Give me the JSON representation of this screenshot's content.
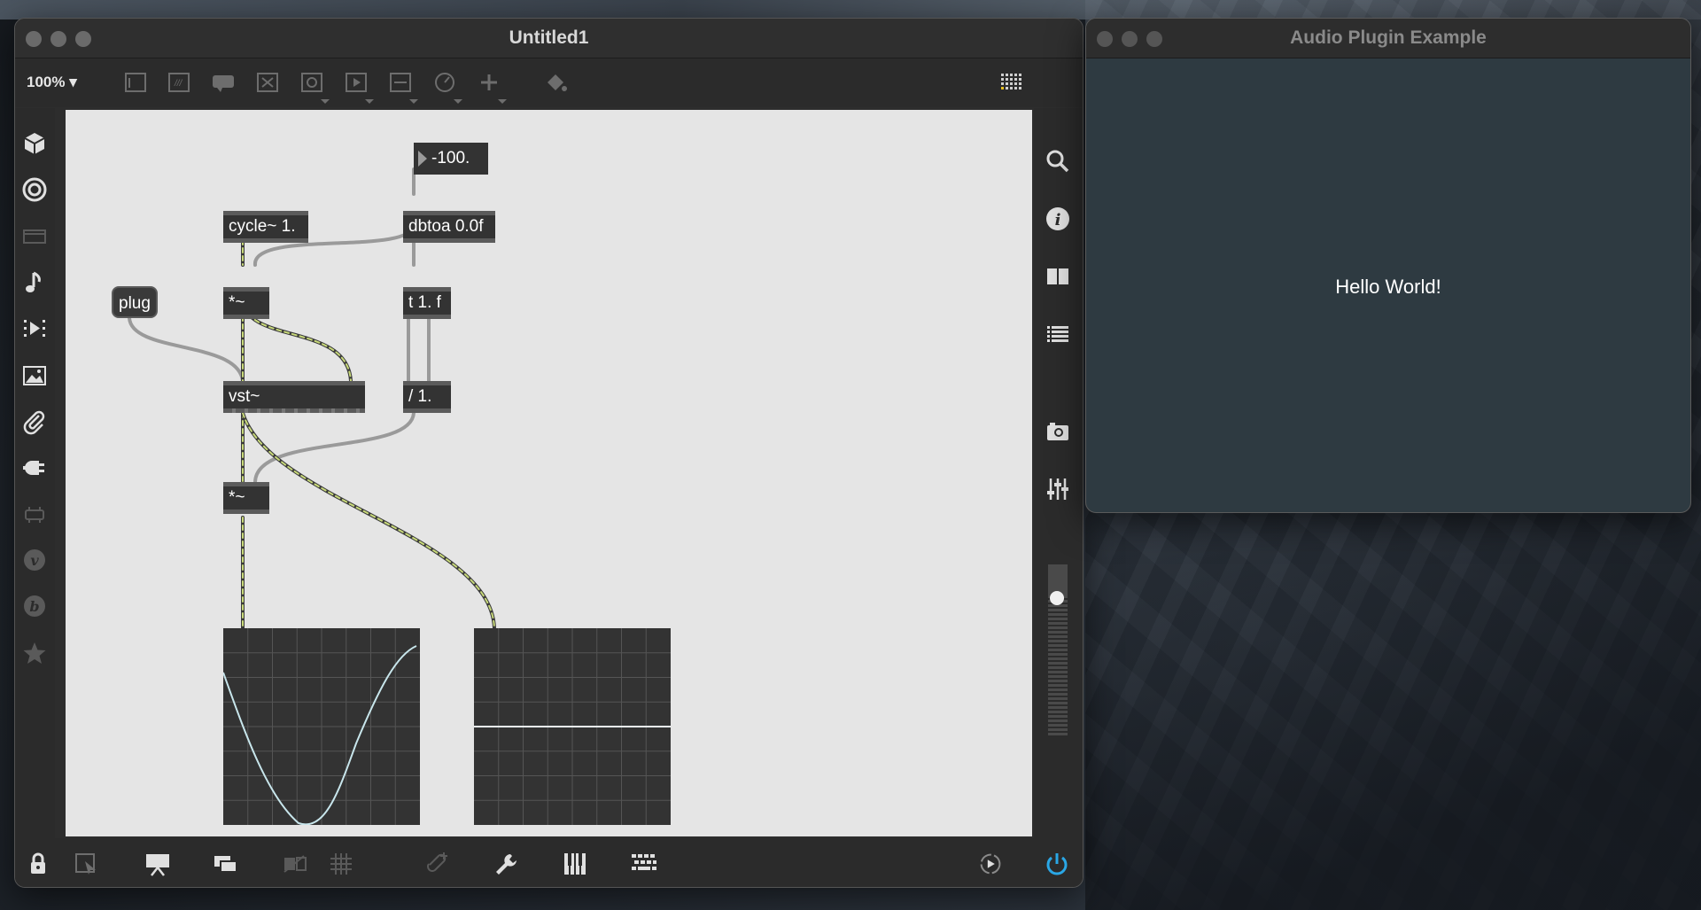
{
  "max_window": {
    "title": "Untitled1",
    "zoom": "100%",
    "toolbar_icons": [
      "presentation-icon",
      "comment-icon",
      "message-icon",
      "toggle-icon",
      "button-icon",
      "play-icon",
      "slider-icon",
      "dial-icon",
      "add-icon",
      "paint-bucket-icon",
      "grid-icon"
    ],
    "left_sidebar_icons": [
      "package-icon",
      "target-icon",
      "film-icon",
      "music-note-icon",
      "media-icon",
      "image-icon",
      "paperclip-icon",
      "plug-icon",
      "connector-icon",
      "v-icon",
      "b-icon",
      "star-icon"
    ],
    "right_sidebar_icons": [
      "search-icon",
      "info-icon",
      "split-view-icon",
      "list-icon",
      "camera-icon",
      "mixer-icon",
      "volume-slider"
    ],
    "bottom_icons": [
      "lock-icon",
      "selection-icon",
      "presentation-icon",
      "windows-icon",
      "hide-icon",
      "grid-icon",
      "add-object-icon",
      "wrench-icon",
      "piano-icon",
      "keyboard-icon",
      "transport-icon",
      "power-icon"
    ],
    "patch": {
      "number_box": "-100.",
      "objects": {
        "cycle": "cycle~ 1.",
        "dbtoa": "dbtoa 0.0f",
        "mult1": "*~",
        "trigger": "t 1. f",
        "vst": "vst~",
        "divide": "/ 1.",
        "mult2": "*~"
      },
      "message": "plug"
    }
  },
  "plugin_window": {
    "title": "Audio Plugin Example",
    "text": "Hello World!"
  },
  "colors": {
    "canvas": "#e5e5e5",
    "object": "#333333",
    "signal_cable": "#c8d97a",
    "control_cable": "#a0a0a0",
    "power": "#2aa7e6"
  }
}
